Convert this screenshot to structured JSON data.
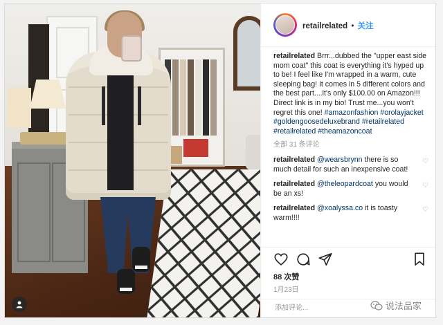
{
  "post": {
    "username": "retailrelated",
    "separator": "•",
    "follow_label": "关注",
    "caption_user": "retailrelated",
    "caption_text": " Brrr...dubbed the \"upper east side mom coat\" this coat is everything it's hyped up to be! I feel like I'm wrapped in a warm, cute sleeping bag! It comes in 5 different colors and the best part....it's only $100.00 on Amazon!!! Direct link is in my bio! Trust me...you won't regret this one!",
    "hashtags": "#amazonfashion #orolayjacket #goldengoosedeluxebrand #retailrelated #retailrelated #theamazoncoat",
    "view_all_comments": "全部 31 条评论",
    "comments": [
      {
        "user": "retailrelated",
        "mention": "@wearsbrynn",
        "text": " there is so much detail for such an inexpensive coat!"
      },
      {
        "user": "retailrelated",
        "mention": "@theleopardcoat",
        "text": " you would be an xs!"
      },
      {
        "user": "retailrelated",
        "mention": "@xoalyssa.co",
        "text": " it is toasty warm!!!!"
      }
    ],
    "likes": "88 次赞",
    "date": "1月23日",
    "add_comment_placeholder": "添加评论..."
  },
  "photo": {
    "badge_letter": "♪"
  },
  "icons": {
    "like": "heart-icon",
    "comment": "comment-bubble-icon",
    "share": "share-plane-icon",
    "save": "bookmark-icon"
  },
  "watermark": {
    "text": "说法品家",
    "icon": "wechat-icon"
  },
  "colors": {
    "accent": "#3897f0",
    "text": "#262626",
    "muted": "#999999",
    "mention": "#003569",
    "border": "#efefef"
  }
}
